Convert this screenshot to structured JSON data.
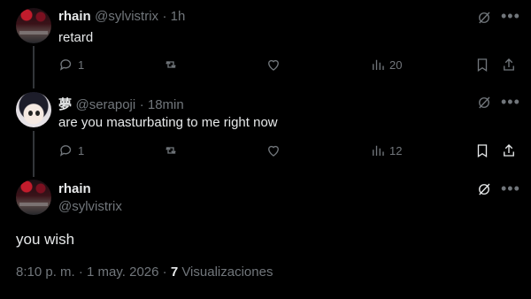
{
  "tweets": [
    {
      "name": "rhain",
      "handle": "@sylvistrix",
      "time": "· 1h",
      "text": "retard",
      "replies": "1",
      "views": "20"
    },
    {
      "name": "夢",
      "handle": "@serapoji",
      "time": "· 18min",
      "text": "are you masturbating to me right now",
      "replies": "1",
      "views": "12"
    }
  ],
  "main": {
    "name": "rhain",
    "handle": "@sylvistrix",
    "text": "you wish",
    "timestamp": "8:10 p. m. · 1 may. 2026 · ",
    "views_count": "7",
    "views_label": "Visualizaciones"
  },
  "icons": {
    "reply": "reply-icon",
    "retweet": "retweet-icon",
    "like": "heart-icon",
    "views": "views-chart-icon",
    "bookmark": "bookmark-icon",
    "share": "share-icon",
    "grok": "grok-icon",
    "more": "more-icon"
  }
}
